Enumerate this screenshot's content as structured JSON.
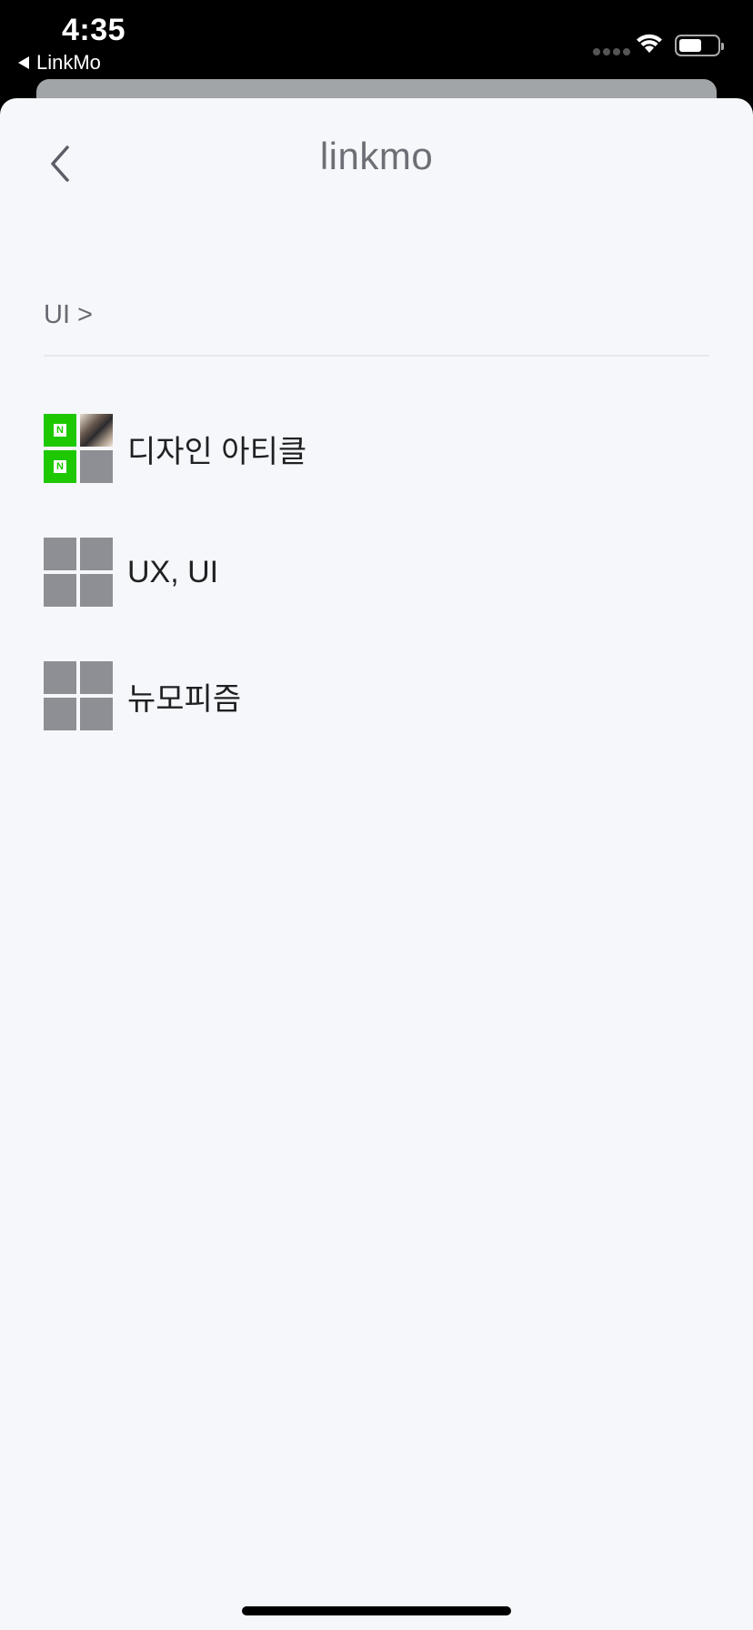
{
  "status_bar": {
    "time": "4:35",
    "back_app_label": "LinkMo",
    "icons": [
      "cellular-signal-icon",
      "wifi-icon",
      "battery-icon"
    ],
    "battery_level": 0.6
  },
  "nav": {
    "back_icon": "chevron-left-icon",
    "title": "linkmo"
  },
  "breadcrumb": {
    "text": "UI >"
  },
  "folders": [
    {
      "label": "디자인 아티클",
      "thumbnail": [
        "naver-logo",
        "photo",
        "naver-logo",
        "empty"
      ]
    },
    {
      "label": "UX, UI",
      "thumbnail": [
        "empty",
        "empty",
        "empty",
        "empty"
      ]
    },
    {
      "label": "뉴모피즘",
      "thumbnail": [
        "empty",
        "empty",
        "empty",
        "empty"
      ]
    }
  ],
  "colors": {
    "sheet_background": "#f5f7fa",
    "naver_green": "#1ec800",
    "placeholder_gray": "#8e8f94",
    "title_gray": "#6c6f75"
  }
}
